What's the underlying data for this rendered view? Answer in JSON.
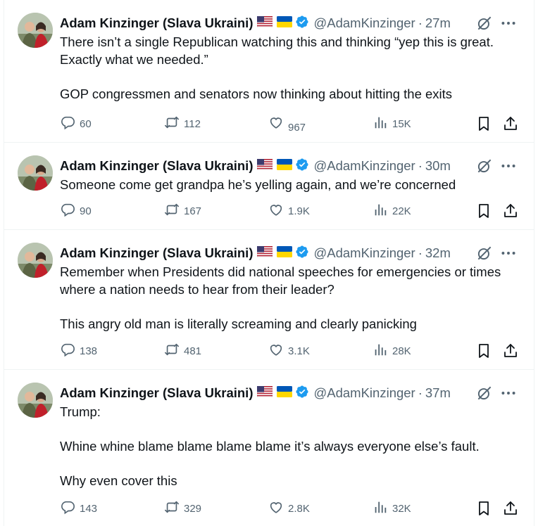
{
  "author": {
    "name": "Adam Kinzinger (Slava Ukraini)",
    "handle": "@AdamKinzinger"
  },
  "separator": "·",
  "colors": {
    "verified": "#1d9bf0",
    "text_primary": "#0f1419",
    "text_secondary": "#536471",
    "divider": "#eff3f4"
  },
  "tweets": [
    {
      "time": "27m",
      "paragraphs": [
        "There isn’t a single Republican watching this and thinking “yep this is great. Exactly what we needed.”",
        "GOP congressmen and senators now thinking about hitting the exits"
      ],
      "replies": "60",
      "retweets": "112",
      "likes": "967",
      "views": "15K"
    },
    {
      "time": "30m",
      "paragraphs": [
        "Someone come get grandpa he’s yelling again, and we’re concerned"
      ],
      "replies": "90",
      "retweets": "167",
      "likes": "1.9K",
      "views": "22K"
    },
    {
      "time": "32m",
      "paragraphs": [
        "Remember when Presidents did national speeches for emergencies or times where a nation needs to hear from their leader?",
        "This angry old man is literally screaming and clearly panicking"
      ],
      "replies": "138",
      "retweets": "481",
      "likes": "3.1K",
      "views": "28K"
    },
    {
      "time": "37m",
      "paragraphs": [
        "Trump:",
        "Whine whine blame blame blame blame it’s always everyone else’s fault.",
        "Why even cover this"
      ],
      "replies": "143",
      "retweets": "329",
      "likes": "2.8K",
      "views": "32K"
    }
  ]
}
